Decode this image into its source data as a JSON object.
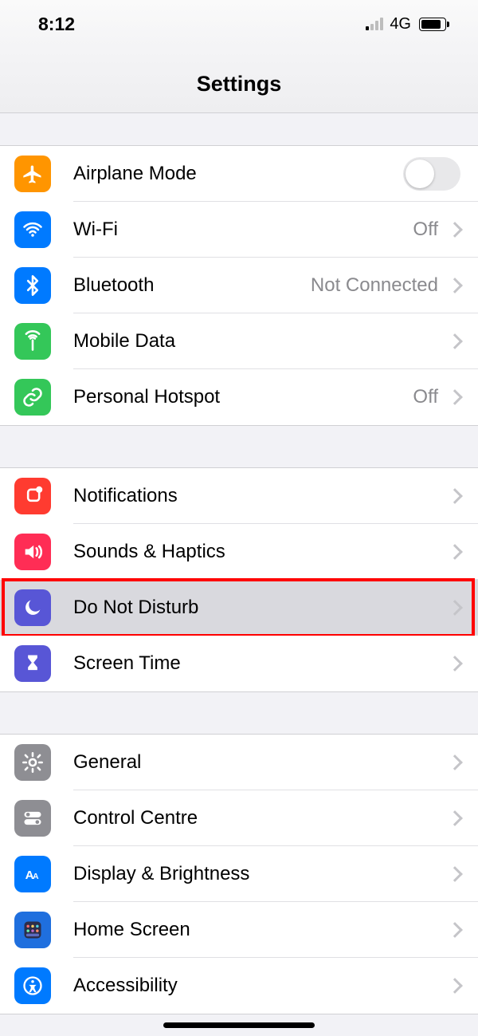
{
  "status": {
    "time": "8:12",
    "network": "4G"
  },
  "title": "Settings",
  "groups": [
    {
      "rows": [
        {
          "id": "airplane",
          "label": "Airplane Mode",
          "icon": "airplane",
          "bg": "bg-orange",
          "type": "toggle",
          "toggle": false
        },
        {
          "id": "wifi",
          "label": "Wi-Fi",
          "icon": "wifi",
          "bg": "bg-blue",
          "type": "link",
          "value": "Off"
        },
        {
          "id": "bluetooth",
          "label": "Bluetooth",
          "icon": "bluetooth",
          "bg": "bg-blue",
          "type": "link",
          "value": "Not Connected"
        },
        {
          "id": "mobile",
          "label": "Mobile Data",
          "icon": "antenna",
          "bg": "bg-green",
          "type": "link"
        },
        {
          "id": "hotspot",
          "label": "Personal Hotspot",
          "icon": "link",
          "bg": "bg-green",
          "type": "link",
          "value": "Off"
        }
      ]
    },
    {
      "rows": [
        {
          "id": "notifications",
          "label": "Notifications",
          "icon": "bell",
          "bg": "bg-red",
          "type": "link"
        },
        {
          "id": "sounds",
          "label": "Sounds & Haptics",
          "icon": "speaker",
          "bg": "bg-pink",
          "type": "link"
        },
        {
          "id": "dnd",
          "label": "Do Not Disturb",
          "icon": "moon",
          "bg": "bg-purple",
          "type": "link",
          "pressed": true,
          "highlight": true
        },
        {
          "id": "screentime",
          "label": "Screen Time",
          "icon": "hourglass",
          "bg": "bg-purple",
          "type": "link"
        }
      ]
    },
    {
      "rows": [
        {
          "id": "general",
          "label": "General",
          "icon": "gear",
          "bg": "bg-gray",
          "type": "link"
        },
        {
          "id": "control",
          "label": "Control Centre",
          "icon": "switches",
          "bg": "bg-gray",
          "type": "link"
        },
        {
          "id": "display",
          "label": "Display & Brightness",
          "icon": "aa",
          "bg": "bg-blue",
          "type": "link"
        },
        {
          "id": "homescreen",
          "label": "Home Screen",
          "icon": "grid",
          "bg": "bg-darkblue",
          "type": "link"
        },
        {
          "id": "accessibility",
          "label": "Accessibility",
          "icon": "person",
          "bg": "bg-blue",
          "type": "link"
        }
      ]
    }
  ]
}
